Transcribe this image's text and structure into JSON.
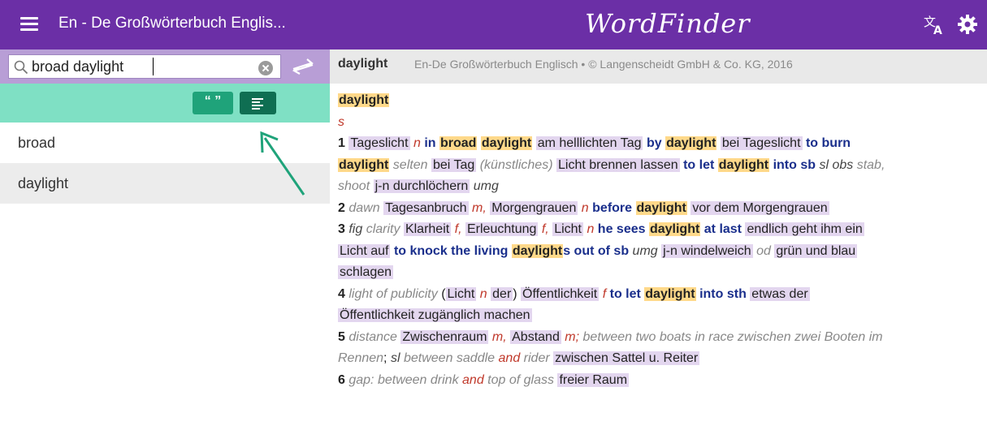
{
  "header": {
    "title": "En - De Großwörterbuch Englis...",
    "logo": "WordFinder",
    "colors": {
      "bar": "#6b2fa6",
      "search_row": "#b89ed6",
      "toolbar_row": "#7fe0c4"
    }
  },
  "search": {
    "value": "broad daylight"
  },
  "toolbar": {
    "quote_label": "“ ”"
  },
  "results": [
    "broad",
    "daylight"
  ],
  "entry": {
    "word": "daylight",
    "source": "En-De Großwörterbuch Englisch • © Langenscheidt GmbH & Co. KG, 2016",
    "headword": "daylight",
    "pos": "s",
    "s1": {
      "num": "1",
      "t1": "Tageslicht",
      "g1": "n",
      "in": "in",
      "broad": "broad",
      "dl1": "daylight",
      "t2": "am helllichten Tag",
      "by": "by",
      "dl2": "daylight",
      "t3": "bei Tageslicht",
      "to_burn": "to burn",
      "dl3": "daylight",
      "selten": "selten",
      "t4": "bei Tag",
      "kuenst": "(künstliches)",
      "t5": "Licht brennen lassen",
      "to_let": "to let",
      "dl4": "daylight",
      "into_sb": "into sb",
      "sl_obs": "sl obs",
      "stab": "stab,",
      "shoot": "shoot",
      "t6": "j-n durchlöchern",
      "umg": "umg"
    },
    "s2": {
      "num": "2",
      "dawn": "dawn",
      "t1": "Tagesanbruch",
      "g1": "m,",
      "t2": "Morgengrauen",
      "g2": "n",
      "before": "before",
      "dl": "daylight",
      "t3": "vor dem Morgengrauen"
    },
    "s3": {
      "num": "3",
      "fig": "fig",
      "clarity": "clarity",
      "t1": "Klarheit",
      "g1": "f,",
      "t2": "Erleuchtung",
      "g2": "f,",
      "t3": "Licht",
      "g3": "n",
      "he_sees": "he sees",
      "dl1": "daylight",
      "at_last": "at last",
      "t4": "endlich geht ihm ein",
      "t4b": "Licht auf",
      "knock": "to knock the living",
      "dl2": "daylight",
      "s_out": "s out of sb",
      "umg": "umg",
      "t5": "j-n windelweich",
      "od": "od",
      "t6": "grün und blau",
      "t6b": "schlagen"
    },
    "s4": {
      "num": "4",
      "pub": "light of publicity",
      "open": "(",
      "t1": "Licht",
      "g1": "n",
      "der": "der",
      "close": ")",
      "t2": "Öffentlichkeit",
      "g2": "f",
      "to_let": "to let",
      "dl": "daylight",
      "into_sth": "into sth",
      "t3": "etwas der",
      "t3b": "Öffentlichkeit zugänglich machen"
    },
    "s5": {
      "num": "5",
      "distance": "distance",
      "t1": "Zwischenraum",
      "g1": "m,",
      "t2": "Abstand",
      "g2": "m;",
      "note1": "between two boats in race zwischen zwei Booten im",
      "note1b": "Rennen",
      "semi": ";",
      "sl": "sl",
      "note2a": "between saddle",
      "and": "and",
      "note2b": "rider",
      "t3": "zwischen Sattel u. Reiter"
    },
    "s6": {
      "num": "6",
      "gap": "gap: between drink",
      "and": "and",
      "top": "top of glass",
      "t1": "freier Raum"
    }
  }
}
